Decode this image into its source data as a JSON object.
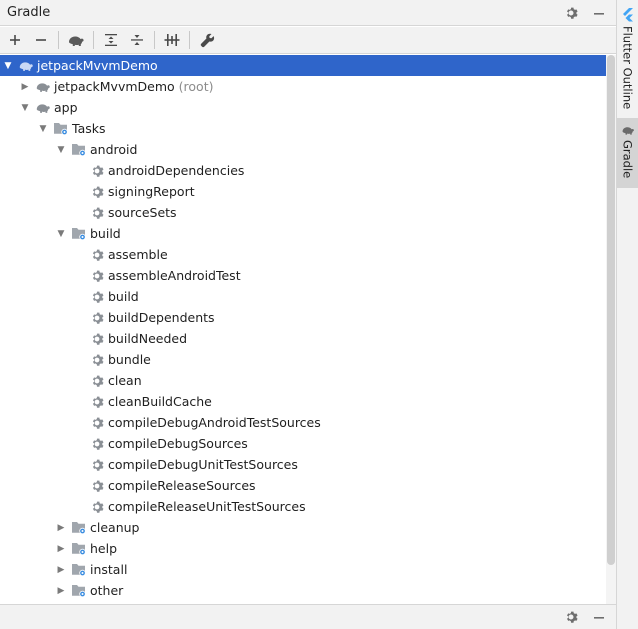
{
  "panel": {
    "title": "Gradle"
  },
  "toolbar": {
    "buttons": [
      "add",
      "remove",
      "execute-gradle-task",
      "expand-all",
      "collapse-all",
      "toggle-offline-mode",
      "build-tool-settings"
    ]
  },
  "tree": {
    "root": {
      "label": "jetpackMvvmDemo"
    },
    "project_root": {
      "label": "jetpackMvvmDemo",
      "suffix": "(root)"
    },
    "app": {
      "label": "app"
    },
    "tasks": {
      "label": "Tasks"
    },
    "android": {
      "label": "android",
      "items": [
        "androidDependencies",
        "signingReport",
        "sourceSets"
      ]
    },
    "build": {
      "label": "build",
      "items": [
        "assemble",
        "assembleAndroidTest",
        "build",
        "buildDependents",
        "buildNeeded",
        "bundle",
        "clean",
        "cleanBuildCache",
        "compileDebugAndroidTestSources",
        "compileDebugSources",
        "compileDebugUnitTestSources",
        "compileReleaseSources",
        "compileReleaseUnitTestSources"
      ]
    },
    "groups": [
      "cleanup",
      "help",
      "install",
      "other"
    ]
  },
  "side_tabs": {
    "flutter_outline": "Flutter Outline",
    "gradle": "Gradle"
  },
  "colors": {
    "selection": "#2f65ca",
    "flutter_icon": "#42a5f5",
    "folder": "#a0a6ad",
    "gear": "#8a8f95"
  }
}
